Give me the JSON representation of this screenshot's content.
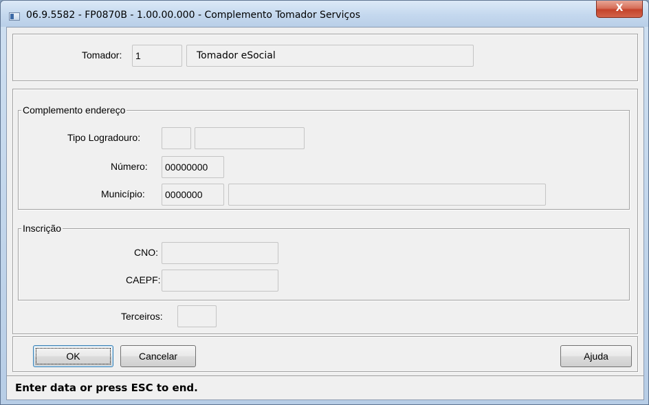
{
  "window": {
    "title": "06.9.5582 - FP0870B - 1.00.00.000 - Complemento Tomador Serviços",
    "close_glyph": "X",
    "icon": "app-window-icon"
  },
  "tomador": {
    "label": "Tomador:",
    "code": "1",
    "name": "Tomador eSocial"
  },
  "endereco": {
    "legend": "Complemento endereço",
    "tipo_logradouro_label": "Tipo Logradouro:",
    "tipo_logradouro_code": "",
    "tipo_logradouro_desc": "",
    "numero_label": "Número:",
    "numero_value": "00000000",
    "municipio_label": "Município:",
    "municipio_code": "0000000",
    "municipio_name": ""
  },
  "inscricao": {
    "legend": "Inscrição",
    "cno_label": "CNO:",
    "cno_value": "",
    "caepf_label": "CAEPF:",
    "caepf_value": ""
  },
  "terceiros": {
    "label": "Terceiros:",
    "value": ""
  },
  "buttons": {
    "ok": "OK",
    "cancel": "Cancelar",
    "help": "Ajuda"
  },
  "status": {
    "message": "Enter data or press ESC to end."
  },
  "colors": {
    "title_bar": "#c4d8ee",
    "close_button": "#c4432b",
    "client_background": "#f0f0f0"
  }
}
